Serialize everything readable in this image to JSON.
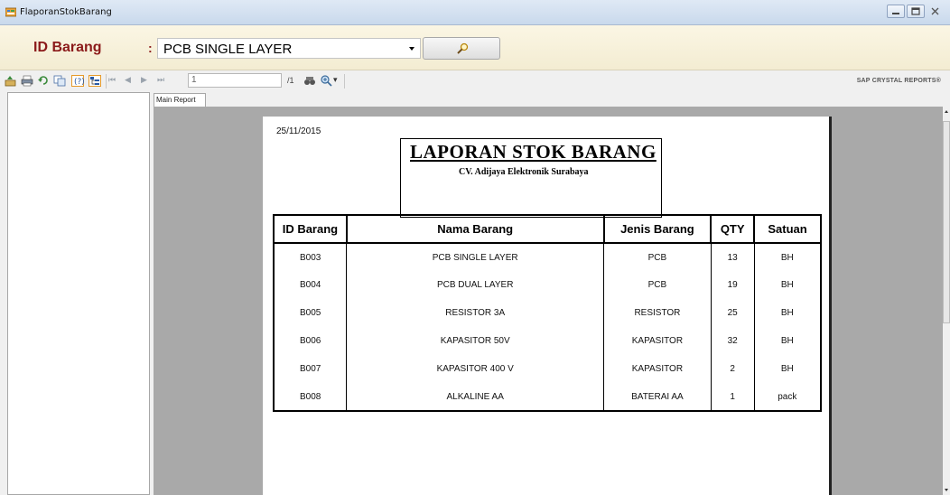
{
  "window": {
    "title": "FlaporanStokBarang"
  },
  "param": {
    "label": "ID Barang",
    "colon": ":",
    "selected": "PCB SINGLE LAYER"
  },
  "toolbar": {
    "page_value": "1",
    "page_total": "/1",
    "brand": "SAP CRYSTAL REPORTS®"
  },
  "tab": {
    "label": "Main Report"
  },
  "report": {
    "date": "25/11/2015",
    "title": "LAPORAN STOK BARANG",
    "subtitle": "CV. Adijaya Elektronik Surabaya",
    "columns": [
      "ID Barang",
      "Nama Barang",
      "Jenis Barang",
      "QTY",
      "Satuan"
    ],
    "rows": [
      [
        "B003",
        "PCB SINGLE LAYER",
        "PCB",
        "13",
        "BH"
      ],
      [
        "B004",
        "PCB DUAL LAYER",
        "PCB",
        "19",
        "BH"
      ],
      [
        "B005",
        "RESISTOR 3A",
        "RESISTOR",
        "25",
        "BH"
      ],
      [
        "B006",
        "KAPASITOR 50V",
        "KAPASITOR",
        "32",
        "BH"
      ],
      [
        "B007",
        "KAPASITOR 400 V",
        "KAPASITOR",
        "2",
        "BH"
      ],
      [
        "B008",
        "ALKALINE AA",
        "BATERAI AA",
        "1",
        "pack"
      ]
    ]
  },
  "colors": {
    "label": "#8b1a1a",
    "param_bg": "#f7f0da",
    "report_bg": "#a9a9a9"
  }
}
